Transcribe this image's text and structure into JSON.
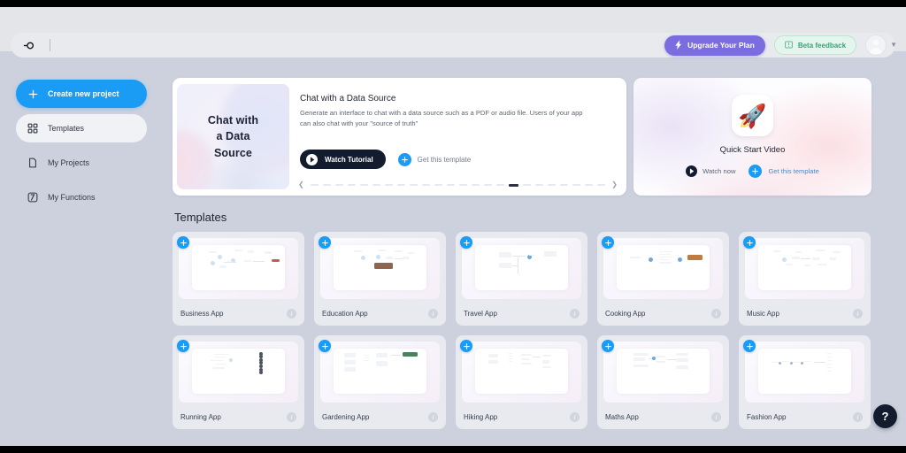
{
  "topbar": {
    "logo_icon": "target-logo-icon",
    "search_placeholder": "",
    "search_value": "",
    "upgrade_label": "Upgrade Your Plan",
    "upgrade_icon": "bolt-icon",
    "upgrade_color": "#7b6ce0",
    "beta_label": "Beta feedback",
    "beta_icon": "book-icon",
    "beta_color": "#3ba37c",
    "avatar_icon": "user-avatar",
    "chevron_icon": "chevron-down-icon"
  },
  "sidebar": {
    "items": [
      {
        "label": "Create new project",
        "icon": "plus-icon",
        "state": "primary"
      },
      {
        "label": "Templates",
        "icon": "grid-icon",
        "state": "active"
      },
      {
        "label": "My Projects",
        "icon": "document-icon",
        "state": "default"
      },
      {
        "label": "My Functions",
        "icon": "function-icon",
        "state": "default"
      }
    ],
    "primary_color": "#1a9cf5"
  },
  "featured": {
    "thumb_text": "Chat with\na Data\nSource",
    "title": "Chat with a Data Source",
    "description": "Generate an interface to chat with a data source such as a PDF or audio file. Users of your app can also chat with your \"source of truth\"",
    "watch_label": "Watch Tutorial",
    "watch_icon": "play-icon",
    "get_template_label": "Get this template",
    "get_template_icon": "plus-circle-icon",
    "carousel": {
      "prev_icon": "chevron-left-icon",
      "next_icon": "chevron-right-icon",
      "total": 24,
      "active_index": 16
    }
  },
  "quickstart": {
    "icon": "rocket-icon",
    "icon_glyph": "🚀",
    "title": "Quick Start Video",
    "watch_label": "Watch now",
    "watch_icon": "play-icon",
    "get_template_label": "Get this template",
    "get_template_icon": "plus-circle-icon"
  },
  "templates": {
    "heading": "Templates",
    "badge_icon": "plus-icon",
    "info_icon": "info-icon",
    "info_glyph": "i",
    "items": [
      {
        "name": "Business App",
        "thumb": "flow-dots-red"
      },
      {
        "name": "Education App",
        "thumb": "flow-brown-card"
      },
      {
        "name": "Travel App",
        "thumb": "flow-boxes"
      },
      {
        "name": "Cooking App",
        "thumb": "flow-orange-card"
      },
      {
        "name": "Music App",
        "thumb": "flow-nodes"
      },
      {
        "name": "Running App",
        "thumb": "flow-list-dots"
      },
      {
        "name": "Gardening App",
        "thumb": "flow-green-card"
      },
      {
        "name": "Hiking App",
        "thumb": "flow-columns"
      },
      {
        "name": "Maths App",
        "thumb": "flow-grid"
      },
      {
        "name": "Fashion App",
        "thumb": "flow-sparse"
      }
    ]
  },
  "help": {
    "label": "?",
    "icon": "question-mark-icon"
  }
}
